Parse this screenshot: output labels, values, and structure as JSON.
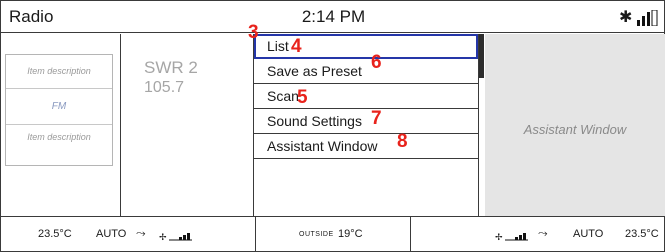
{
  "status_bar": {
    "title": "Radio",
    "time": "2:14 PM",
    "bluetooth_icon": "bluetooth-icon",
    "signal_icon": "signal-strength-icon"
  },
  "left_panel": {
    "item_top": "Item description",
    "item_mid": "FM",
    "item_bottom": "Item description"
  },
  "station": {
    "name": "SWR 2",
    "frequency": "105.7"
  },
  "menu": {
    "items": [
      {
        "label": "List",
        "marker": "4"
      },
      {
        "label": "Save as Preset",
        "marker": "6"
      },
      {
        "label": "Scan",
        "marker": "5"
      },
      {
        "label": "Sound Settings",
        "marker": "7"
      },
      {
        "label": "Assistant Window",
        "marker": "8"
      }
    ],
    "selected_marker": "3",
    "selection_color": "#2536a8"
  },
  "assistant": {
    "label": "Assistant Window"
  },
  "climate": {
    "left_temp": "23.5°C",
    "left_mode": "AUTO",
    "outside_label": "OUTSIDE",
    "outside_temp": "19°C",
    "right_mode": "AUTO",
    "right_temp": "23.5°C"
  },
  "colors": {
    "marker": "#e8231c",
    "assistant_bg": "#e5e5e5"
  }
}
